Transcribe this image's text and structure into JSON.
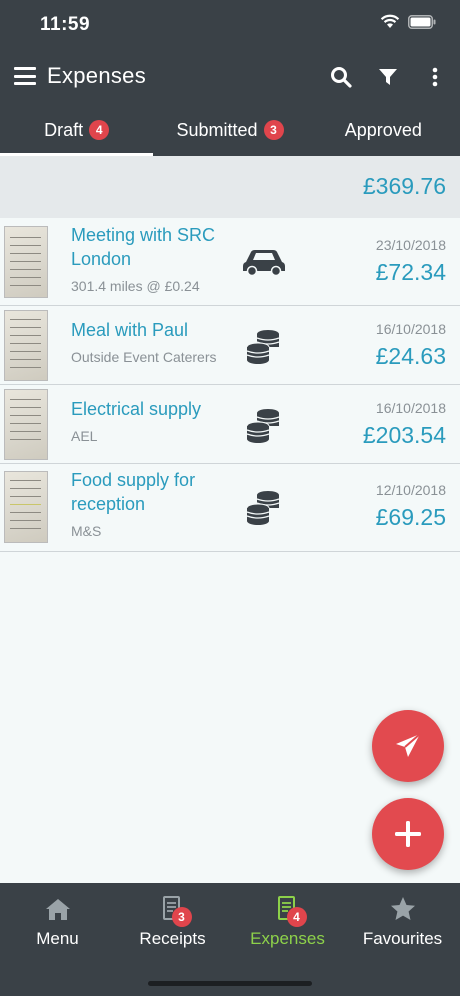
{
  "status_bar": {
    "time": "11:59"
  },
  "app_bar": {
    "title": "Expenses"
  },
  "tabs": [
    {
      "label": "Draft",
      "badge": "4",
      "active": true
    },
    {
      "label": "Submitted",
      "badge": "3",
      "active": false
    },
    {
      "label": "Approved",
      "badge": null,
      "active": false
    }
  ],
  "total": "£369.76",
  "expenses": [
    {
      "title_line1": "Meeting with SRC",
      "title_line2": "London",
      "subtitle": "301.4 miles @ £0.24",
      "icon": "car-icon",
      "date": "23/10/2018",
      "amount": "£72.34"
    },
    {
      "title_line1": "Meal with Paul",
      "title_line2": "",
      "subtitle": "Outside Event Caterers",
      "icon": "coins-icon",
      "date": "16/10/2018",
      "amount": "£24.63"
    },
    {
      "title_line1": "Electrical supply",
      "title_line2": "",
      "subtitle": "AEL",
      "icon": "coins-icon",
      "date": "16/10/2018",
      "amount": "£203.54"
    },
    {
      "title_line1": "Food supply for",
      "title_line2": "reception",
      "subtitle": "M&S",
      "icon": "coins-icon",
      "date": "12/10/2018",
      "amount": "£69.25"
    }
  ],
  "bottom_nav": [
    {
      "label": "Menu",
      "icon": "home-icon",
      "badge": null,
      "active": false
    },
    {
      "label": "Receipts",
      "icon": "receipt-icon",
      "badge": "3",
      "active": false
    },
    {
      "label": "Expenses",
      "icon": "expenses-icon",
      "badge": "4",
      "active": true
    },
    {
      "label": "Favourites",
      "icon": "star-icon",
      "badge": null,
      "active": false
    }
  ],
  "colors": {
    "header": "#3a4147",
    "accent": "#2a9bbd",
    "badge": "#e0454c",
    "fab": "#e24a4f",
    "nav_active": "#8dd14a"
  }
}
